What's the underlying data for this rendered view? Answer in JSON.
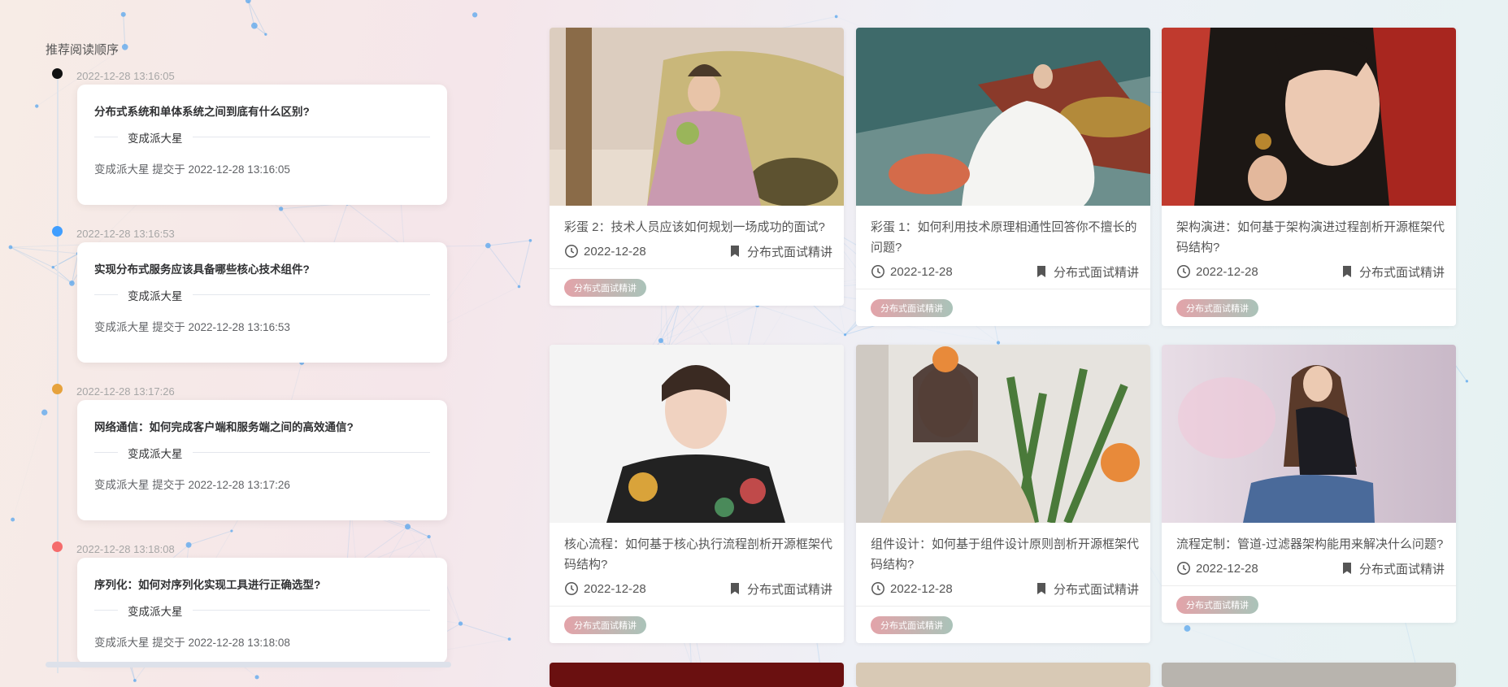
{
  "sidebar": {
    "title": "推荐阅读顺序",
    "items": [
      {
        "time": "2022-12-28 13:16:05",
        "dot_color": "#111111",
        "title": "分布式系统和单体系统之间到底有什么区别?",
        "author": "变成派大星",
        "meta": "变成派大星 提交于 2022-12-28 13:16:05"
      },
      {
        "time": "2022-12-28 13:16:53",
        "dot_color": "#409eff",
        "title": "实现分布式服务应该具备哪些核心技术组件?",
        "author": "变成派大星",
        "meta": "变成派大星 提交于 2022-12-28 13:16:53"
      },
      {
        "time": "2022-12-28 13:17:26",
        "dot_color": "#e6a23c",
        "title": "网络通信：如何完成客户端和服务端之间的高效通信?",
        "author": "变成派大星",
        "meta": "变成派大星 提交于 2022-12-28 13:17:26"
      },
      {
        "time": "2022-12-28 13:18:08",
        "dot_color": "#f56c6c",
        "title": "序列化：如何对序列化实现工具进行正确选型?",
        "author": "变成派大星",
        "meta": "变成派大星 提交于 2022-12-28 13:18:08"
      }
    ]
  },
  "cards": [
    {
      "title": "彩蛋 2：技术人员应该如何规划一场成功的面试?",
      "date": "2022-12-28",
      "category": "分布式面试精讲",
      "tag": "分布式面试精讲",
      "image": "photo-woman-car-coconut"
    },
    {
      "title": "彩蛋 1：如何利用技术原理相通性回答你不擅长的问题?",
      "date": "2022-12-28",
      "category": "分布式面试精讲",
      "tag": "分布式面试精讲",
      "image": "photo-woman-white-dress-boat"
    },
    {
      "title": "架构演进：如何基于架构演进过程剖析开源框架代码结构?",
      "date": "2022-12-28",
      "category": "分布式面试精讲",
      "tag": "分布式面试精讲",
      "image": "photo-woman-red-background"
    },
    {
      "title": "核心流程：如何基于核心执行流程剖析开源框架代码结构?",
      "date": "2022-12-28",
      "category": "分布式面试精讲",
      "tag": "分布式面试精讲",
      "image": "photo-woman-floral-dress"
    },
    {
      "title": "组件设计：如何基于组件设计原则剖析开源框架代码结构?",
      "date": "2022-12-28",
      "category": "分布式面试精讲",
      "tag": "分布式面试精讲",
      "image": "photo-woman-orange-plant"
    },
    {
      "title": "流程定制：管道-过滤器架构能用来解决什么问题?",
      "date": "2022-12-28",
      "category": "分布式面试精讲",
      "tag": "分布式面试精讲",
      "image": "photo-woman-sitting-jeans"
    }
  ],
  "colors": {
    "accent": "#409eff",
    "tag_start": "#e3a3a9",
    "tag_end": "#aac3b9"
  },
  "icons": {
    "date": "clock-icon",
    "category": "bookmark-icon"
  }
}
